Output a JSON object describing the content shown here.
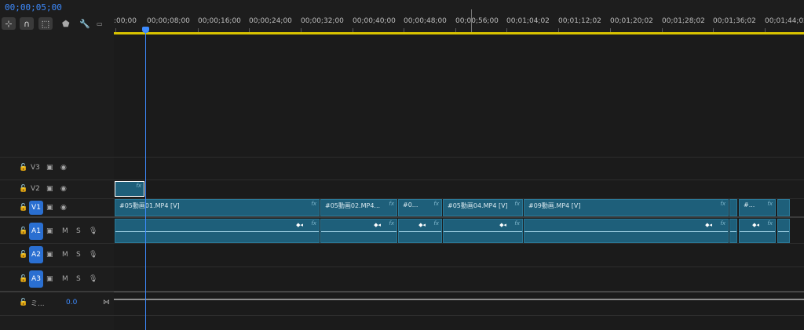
{
  "timecode": "00;00;05;00",
  "ruler_labels": [
    ":00;00",
    "00;00;08;00",
    "00;00;16;00",
    "00;00;24;00",
    "00;00;32;00",
    "00;00;40;00",
    "00;00;48;00",
    "00;00;56;00",
    "00;01;04;02",
    "00;01;12;02",
    "00;01;20;02",
    "00;01;28;02",
    "00;01;36;02",
    "00;01;44;02"
  ],
  "tracks": {
    "v3": {
      "name": "V3"
    },
    "v2": {
      "name": "V2"
    },
    "v1": {
      "name": "V1"
    },
    "a1": {
      "name": "A1",
      "m": "M",
      "s": "S"
    },
    "a2": {
      "name": "A2",
      "m": "M",
      "s": "S"
    },
    "a3": {
      "name": "A3",
      "m": "M",
      "s": "S"
    },
    "mix": {
      "name": "ミ...",
      "value": "0.0"
    }
  },
  "video_clips": [
    {
      "label": "#05動画01.MP4 [V]"
    },
    {
      "label": "#05動画02.MP4..."
    },
    {
      "label": "#0..."
    },
    {
      "label": "#05動画04.MP4 [V]"
    },
    {
      "label": "#09動画.MP4 [V]"
    },
    {
      "label": ""
    },
    {
      "label": "#..."
    },
    {
      "label": ""
    }
  ],
  "fx_label": "fx",
  "icons": {
    "snap": "snap-icon",
    "magnet": "magnet-icon",
    "linked": "linked-selection-icon",
    "marker": "marker-icon",
    "wrench": "wrench-icon",
    "caption": "caption-icon",
    "lock": "lock-icon",
    "camera": "camera-icon",
    "eye": "eye-icon",
    "mic": "mic-icon"
  },
  "colors": {
    "accent": "#3d8bff",
    "clip": "#1e5f7a",
    "workbar": "#d8c200"
  }
}
